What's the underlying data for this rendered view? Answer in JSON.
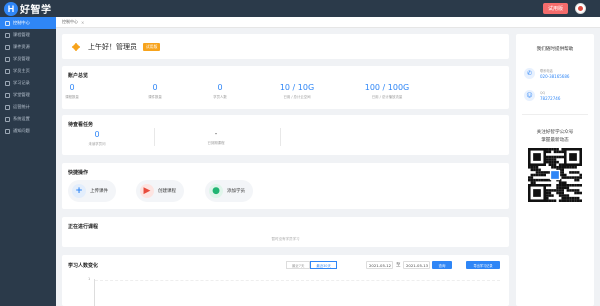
{
  "app": {
    "logo_letter": "H",
    "name": "好智学"
  },
  "header": {
    "trial_label": "试用版"
  },
  "sidebar": {
    "items": [
      {
        "label": "控制中心",
        "active": true
      },
      {
        "label": "课程管理",
        "active": false
      },
      {
        "label": "课件资源",
        "active": false
      },
      {
        "label": "学员管理",
        "active": false
      },
      {
        "label": "学员主页",
        "active": false
      },
      {
        "label": "学习记录",
        "active": false
      },
      {
        "label": "学堂管理",
        "active": false
      },
      {
        "label": "运营统计",
        "active": false
      },
      {
        "label": "系统设置",
        "active": false
      },
      {
        "label": "通知问题",
        "active": false
      }
    ]
  },
  "breadcrumb": {
    "tab_label": "控制中心",
    "close_glyph": "×"
  },
  "greeting": {
    "text": "上午好！管理员",
    "badge": "试用版"
  },
  "overview": {
    "title": "账户总览",
    "stats": [
      {
        "value": "0",
        "label": "课程数量"
      },
      {
        "value": "0",
        "label": "课件数量"
      },
      {
        "value": "0",
        "label": "学员人数"
      },
      {
        "value": "10 / 10G",
        "label": "已用 / 总计云空间"
      },
      {
        "value": "100 / 100G",
        "label": "已用 / 总计播放流量"
      }
    ]
  },
  "pending": {
    "title": "待查看任务",
    "items": [
      {
        "value": "0",
        "label": "未读学员问"
      },
      {
        "value": "-",
        "label": "已到期课程"
      }
    ]
  },
  "quick": {
    "title": "快捷操作",
    "buttons": [
      {
        "icon": "+",
        "label": "上传课件",
        "color": "#2f86f6",
        "bg": "#e3eefc"
      },
      {
        "icon": "▶",
        "label": "创建课程",
        "color": "#e84c3d",
        "bg": "#fde4e1"
      },
      {
        "icon": "●",
        "label": "添加学员",
        "color": "#22b573",
        "bg": "#dff5ea"
      }
    ]
  },
  "ongoing": {
    "title": "正在进行课程",
    "empty": "暂时没有学员学习"
  },
  "learning": {
    "title": "学习人数变化",
    "ranges": [
      {
        "label": "最近7天",
        "active": false
      },
      {
        "label": "最近30天",
        "active": true
      }
    ],
    "date_from": "2021-05-12",
    "date_sep": "至",
    "date_to": "2021-05-13",
    "query_label": "查询",
    "export_label": "导出学习记录",
    "y_tick": "1"
  },
  "help": {
    "title": "我们随时提供帮助",
    "phone_label": "联系电话",
    "phone": "020-38165686",
    "qq_label": "QQ",
    "qq": "78272746",
    "follow_line1": "关注好智学公众号",
    "follow_line2": "掌握最新动态"
  }
}
